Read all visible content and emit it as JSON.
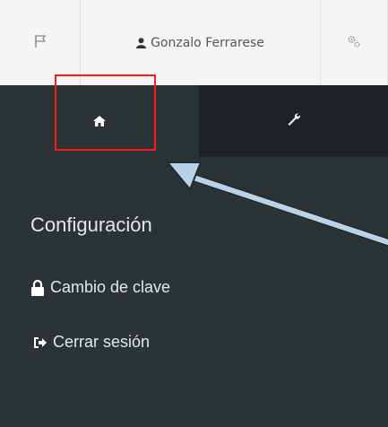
{
  "topbar": {
    "user_name": "Gonzalo Ferrarese"
  },
  "sidebar": {
    "tabs": [
      {
        "name": "home",
        "icon": "home-icon",
        "active": true
      },
      {
        "name": "tools",
        "icon": "wrench-icon",
        "active": false
      }
    ],
    "section_title": "Configuración",
    "menu": [
      {
        "label": "Cambio de clave",
        "icon": "lock-icon"
      },
      {
        "label": "Cerrar sesión",
        "icon": "sign-out-icon"
      }
    ]
  },
  "annotation": {
    "highlight_color": "#ff1a1a",
    "arrow_color": "#b9d2ea"
  },
  "colors": {
    "sidebar_bg": "#2b3337",
    "tab_inactive_bg": "#1c2225",
    "topbar_bg": "#f5f5f5"
  }
}
